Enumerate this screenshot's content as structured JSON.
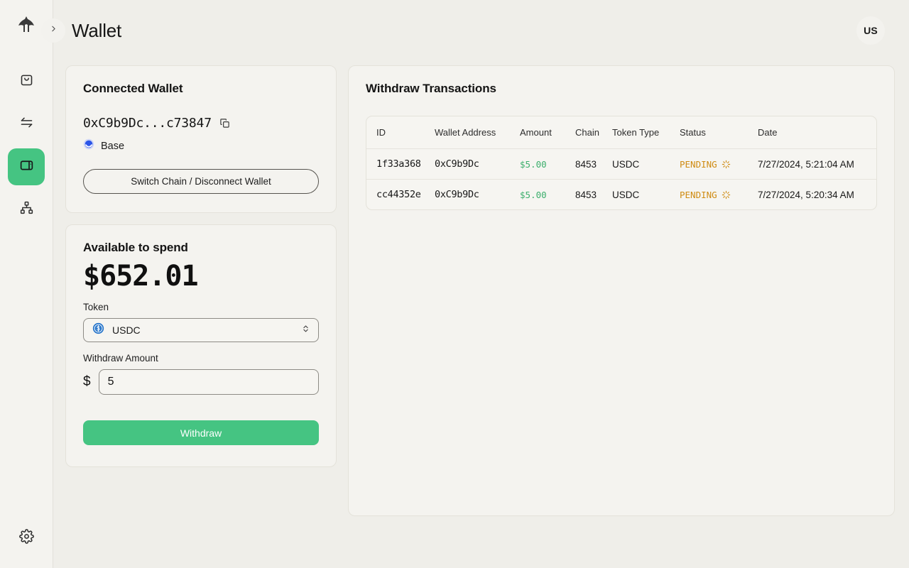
{
  "brand": {
    "logo_icon": "eagle-logo-icon"
  },
  "sidebar": {
    "items": [
      {
        "icon": "shopping-bag-icon",
        "name": "orders",
        "active": false
      },
      {
        "icon": "transfer-arrows-icon",
        "name": "transfers",
        "active": false
      },
      {
        "icon": "wallet-icon",
        "name": "wallet",
        "active": true
      },
      {
        "icon": "network-nodes-icon",
        "name": "network",
        "active": false
      }
    ],
    "settings": {
      "icon": "gear-icon",
      "name": "settings"
    }
  },
  "topbar": {
    "collapse_icon": "chevron-right-icon",
    "title": "Wallet",
    "avatar_initials": "US"
  },
  "connected_wallet": {
    "title": "Connected Wallet",
    "address": "0xC9b9Dc...c73847",
    "copy_icon": "copy-icon",
    "chain_icon": "base-chain-icon",
    "chain_name": "Base",
    "switch_button": "Switch Chain / Disconnect Wallet"
  },
  "available_to_spend": {
    "title": "Available to spend",
    "balance": "$652.01",
    "token_label": "Token",
    "token_icon": "usdc-coin-icon",
    "token_value": "USDC",
    "token_options": [
      "USDC"
    ],
    "select_chevron_icon": "chevron-up-down-icon",
    "amount_label": "Withdraw Amount",
    "currency_symbol": "$",
    "amount_value": "5",
    "amount_placeholder": "0",
    "withdraw_button": "Withdraw"
  },
  "transactions": {
    "title": "Withdraw Transactions",
    "columns": [
      "ID",
      "Wallet Address",
      "Amount",
      "Chain",
      "Token Type",
      "Status",
      "Date"
    ],
    "rows": [
      {
        "id": "1f33a368",
        "wallet_address": "0xC9b9Dc",
        "amount": "$5.00",
        "chain": "8453",
        "token_type": "USDC",
        "status": "PENDING",
        "status_icon": "spinner-icon",
        "date": "7/27/2024, 5:21:04 AM"
      },
      {
        "id": "cc44352e",
        "wallet_address": "0xC9b9Dc",
        "amount": "$5.00",
        "chain": "8453",
        "token_type": "USDC",
        "status": "PENDING",
        "status_icon": "spinner-icon",
        "date": "7/27/2024, 5:20:34 AM"
      }
    ]
  },
  "colors": {
    "accent_green": "#45c482",
    "amount_green": "#3cae6c",
    "status_orange": "#cf8b12",
    "page_bg": "#efeee9",
    "card_bg": "#f4f3ef",
    "base_blue": "#2b55e8",
    "usdc_blue": "#2775ca"
  }
}
